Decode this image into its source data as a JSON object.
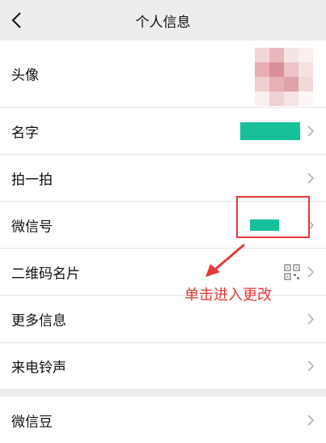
{
  "header": {
    "title": "个人信息"
  },
  "rows": {
    "avatar": "头像",
    "name": "名字",
    "pat": "拍一拍",
    "wechat_id": "微信号",
    "qr_card": "二维码名片",
    "more_info": "更多信息",
    "ringtone": "来电铃声",
    "wechat_beans": "微信豆"
  },
  "annotation": {
    "text": "单击进入更改"
  },
  "colors": {
    "redacted": "#17c09b",
    "annotation": "#e53935"
  }
}
